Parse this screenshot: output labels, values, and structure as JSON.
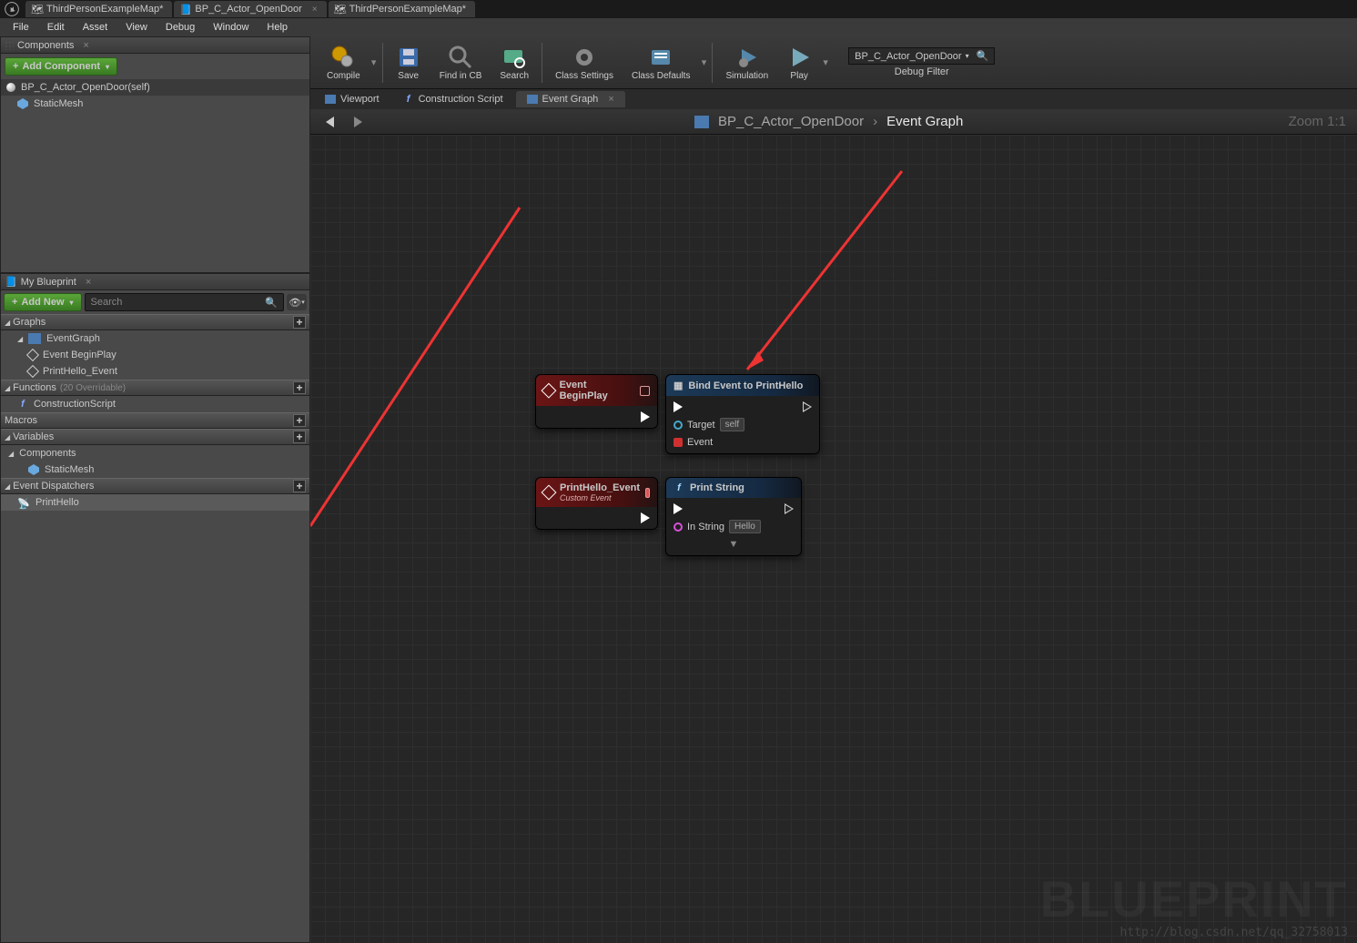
{
  "tabs": [
    "ThirdPersonExampleMap*",
    "BP_C_Actor_OpenDoor",
    "ThirdPersonExampleMap*"
  ],
  "menu": [
    "File",
    "Edit",
    "Asset",
    "View",
    "Debug",
    "Window",
    "Help"
  ],
  "components": {
    "title": "Components",
    "addBtn": "Add Component",
    "root": "BP_C_Actor_OpenDoor(self)",
    "child": "StaticMesh"
  },
  "mybp": {
    "title": "My Blueprint",
    "addBtn": "Add New",
    "searchPlaceholder": "Search",
    "cats": {
      "graphs": "Graphs",
      "functions": "Functions",
      "functionsOver": "(20 Overridable)",
      "macros": "Macros",
      "variables": "Variables",
      "comps": "Components",
      "disp": "Event Dispatchers"
    },
    "eventGraph": "EventGraph",
    "events": [
      "Event BeginPlay",
      "PrintHello_Event"
    ],
    "construction": "ConstructionScript",
    "staticMesh": "StaticMesh",
    "dispatcher": "PrintHello"
  },
  "toolbar": {
    "compile": "Compile",
    "save": "Save",
    "find": "Find in CB",
    "search": "Search",
    "classSettings": "Class Settings",
    "classDefaults": "Class Defaults",
    "simulation": "Simulation",
    "play": "Play",
    "debugFilter": "Debug Filter",
    "debugValue": "BP_C_Actor_OpenDoor"
  },
  "graphTabs": {
    "viewport": "Viewport",
    "construction": "Construction Script",
    "eventGraph": "Event Graph"
  },
  "breadcrumb": {
    "asset": "BP_C_Actor_OpenDoor",
    "graph": "Event Graph",
    "zoom": "Zoom 1:1"
  },
  "nodes": {
    "beginPlay": {
      "title": "Event BeginPlay"
    },
    "bind": {
      "title": "Bind Event to PrintHello",
      "target": "Target",
      "self": "self",
      "event": "Event"
    },
    "customEvent": {
      "title": "PrintHello_Event",
      "sub": "Custom Event"
    },
    "print": {
      "title": "Print String",
      "inString": "In String",
      "hello": "Hello"
    }
  },
  "watermark": "BLUEPRINT",
  "blogUrl": "http://blog.csdn.net/qq_32758013"
}
